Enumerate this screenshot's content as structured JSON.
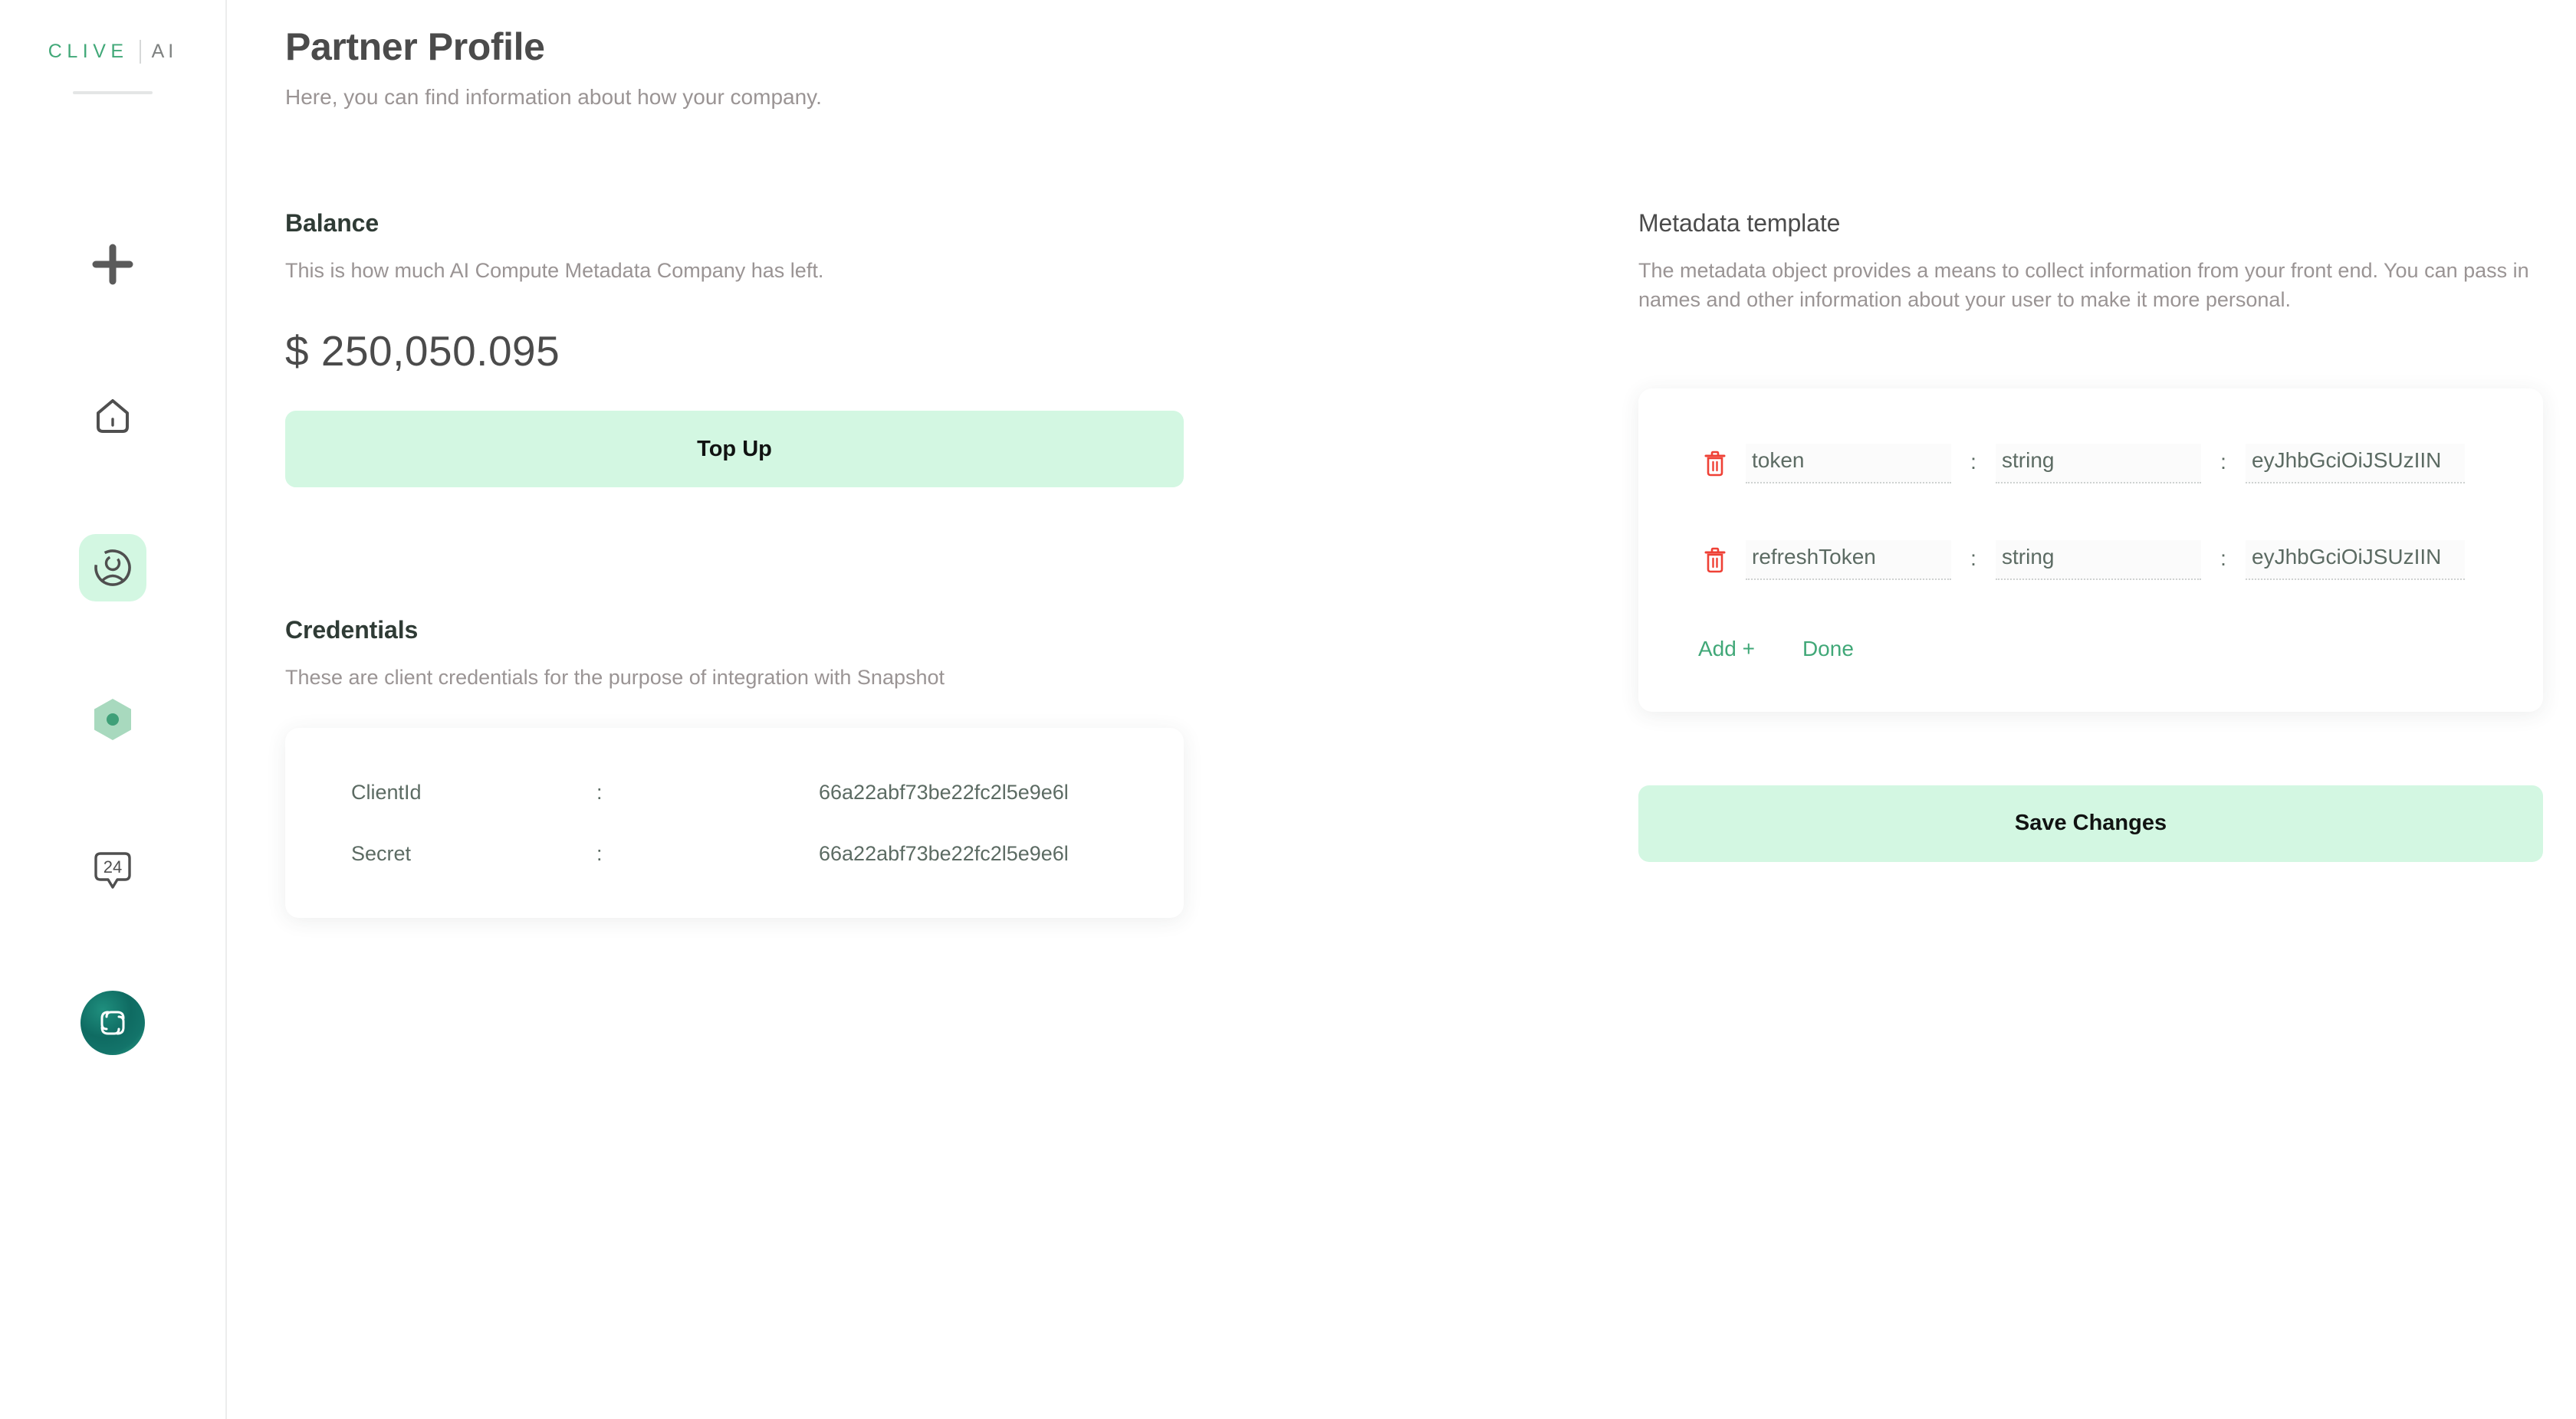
{
  "brand": {
    "name_primary": "CLIVE",
    "name_secondary": "AI",
    "primary_color": "#41a878",
    "secondary_color": "#7e8180"
  },
  "sidebar": {
    "items": [
      {
        "icon": "plus-icon",
        "label": "Add",
        "active": false
      },
      {
        "icon": "home-icon",
        "label": "Home",
        "active": false
      },
      {
        "icon": "user-profile-icon",
        "label": "Partner Profile",
        "active": true
      },
      {
        "icon": "hexagon-node-icon",
        "label": "Nodes",
        "active": false
      },
      {
        "icon": "support-24-icon",
        "label": "Support 24",
        "active": false
      },
      {
        "icon": "snapshot-logo-icon",
        "label": "Snapshot",
        "active": false
      }
    ],
    "badge_text": "24"
  },
  "header": {
    "title": "Partner Profile",
    "subtitle": "Here, you can find information about how your company."
  },
  "balance": {
    "heading": "Balance",
    "description": "This is how much AI Compute Metadata Company has left.",
    "currency_symbol": "$",
    "amount": "250,050.095",
    "amount_display": "$ 250,050.095",
    "topup_label": "Top Up",
    "button_color": "#d3f7e2"
  },
  "credentials": {
    "heading": "Credentials",
    "description": "These are client credentials for the purpose of integration with Snapshot",
    "separator": ":",
    "rows": [
      {
        "key": "ClientId",
        "value": "66a22abf73be22fc2l5e9e6l"
      },
      {
        "key": "Secret",
        "value": "66a22abf73be22fc2l5e9e6l"
      }
    ]
  },
  "metadata": {
    "heading": "Metadata template",
    "description": "The metadata object provides a means to collect information from your front end. You can pass in names and other information about your user to make it more personal.",
    "separator": ":",
    "delete_icon": "trash-icon",
    "delete_color": "#ef4136",
    "rows": [
      {
        "name": "token",
        "type": "string",
        "value": "eyJhbGciOiJSUzIIN"
      },
      {
        "name": "refreshToken",
        "type": "string",
        "value": "eyJhbGciOiJSUzIIN"
      }
    ],
    "add_label": "Add +",
    "done_label": "Done",
    "link_color": "#41a878",
    "save_label": "Save Changes",
    "save_color": "#d3f7e2"
  }
}
